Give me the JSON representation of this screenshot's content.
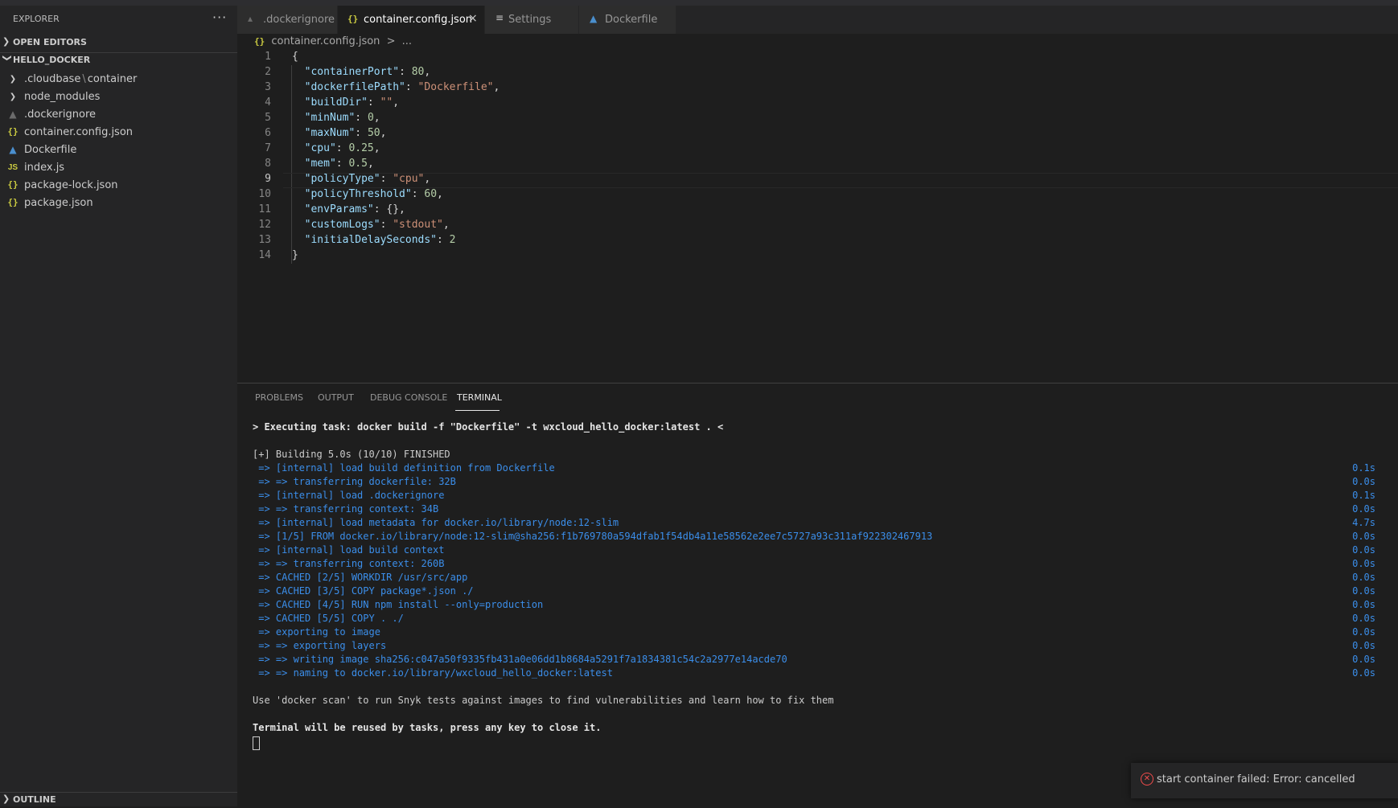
{
  "sidebar": {
    "header": "EXPLORER",
    "more": "···",
    "open_editors": "OPEN EDITORS",
    "project": "HELLO_DOCKER",
    "items": [
      {
        "label": ".cloudbase",
        "sep": "\\",
        "label2": "container",
        "icon": "chevron-right-icon"
      },
      {
        "label": "node_modules",
        "icon": "chevron-right-icon"
      },
      {
        "label": ".dockerignore",
        "icon": "dockerignore-icon"
      },
      {
        "label": "container.config.json",
        "icon": "json-icon",
        "glyph": "{}"
      },
      {
        "label": "Dockerfile",
        "icon": "docker-icon"
      },
      {
        "label": "index.js",
        "icon": "js-icon",
        "glyph": "JS"
      },
      {
        "label": "package-lock.json",
        "icon": "json-icon",
        "glyph": "{}"
      },
      {
        "label": "package.json",
        "icon": "json-icon",
        "glyph": "{}"
      }
    ],
    "outline": "OUTLINE"
  },
  "tabs": [
    {
      "label": ".dockerignore",
      "icon": "dockerignore-icon"
    },
    {
      "label": "container.config.json",
      "icon": "json-icon",
      "glyph": "{}",
      "close": "×"
    },
    {
      "label": "Settings",
      "icon": "settings-list-icon",
      "glyph": "≡"
    },
    {
      "label": "Dockerfile",
      "icon": "docker-icon"
    }
  ],
  "breadcrumb": {
    "glyph": "{}",
    "file": "container.config.json",
    "sep": ">",
    "more": "..."
  },
  "editor": {
    "current_line": 9,
    "lines": [
      {
        "no": "1",
        "parts": [
          [
            "p",
            "{"
          ]
        ]
      },
      {
        "no": "2",
        "parts": [
          [
            "k",
            "  \"containerPort\""
          ],
          [
            "p",
            ": "
          ],
          [
            "n",
            "80"
          ],
          [
            "p",
            ","
          ]
        ]
      },
      {
        "no": "3",
        "parts": [
          [
            "k",
            "  \"dockerfilePath\""
          ],
          [
            "p",
            ": "
          ],
          [
            "s",
            "\"Dockerfile\""
          ],
          [
            "p",
            ","
          ]
        ]
      },
      {
        "no": "4",
        "parts": [
          [
            "k",
            "  \"buildDir\""
          ],
          [
            "p",
            ": "
          ],
          [
            "s",
            "\"\""
          ],
          [
            "p",
            ","
          ]
        ]
      },
      {
        "no": "5",
        "parts": [
          [
            "k",
            "  \"minNum\""
          ],
          [
            "p",
            ": "
          ],
          [
            "n",
            "0"
          ],
          [
            "p",
            ","
          ]
        ]
      },
      {
        "no": "6",
        "parts": [
          [
            "k",
            "  \"maxNum\""
          ],
          [
            "p",
            ": "
          ],
          [
            "n",
            "50"
          ],
          [
            "p",
            ","
          ]
        ]
      },
      {
        "no": "7",
        "parts": [
          [
            "k",
            "  \"cpu\""
          ],
          [
            "p",
            ": "
          ],
          [
            "n",
            "0.25"
          ],
          [
            "p",
            ","
          ]
        ]
      },
      {
        "no": "8",
        "parts": [
          [
            "k",
            "  \"mem\""
          ],
          [
            "p",
            ": "
          ],
          [
            "n",
            "0.5"
          ],
          [
            "p",
            ","
          ]
        ]
      },
      {
        "no": "9",
        "parts": [
          [
            "k",
            "  \"policyType\""
          ],
          [
            "p",
            ": "
          ],
          [
            "s",
            "\"cpu\""
          ],
          [
            "p",
            ","
          ]
        ]
      },
      {
        "no": "10",
        "parts": [
          [
            "k",
            "  \"policyThreshold\""
          ],
          [
            "p",
            ": "
          ],
          [
            "n",
            "60"
          ],
          [
            "p",
            ","
          ]
        ]
      },
      {
        "no": "11",
        "parts": [
          [
            "k",
            "  \"envParams\""
          ],
          [
            "p",
            ": {},"
          ]
        ]
      },
      {
        "no": "12",
        "parts": [
          [
            "k",
            "  \"customLogs\""
          ],
          [
            "p",
            ": "
          ],
          [
            "s",
            "\"stdout\""
          ],
          [
            "p",
            ","
          ]
        ]
      },
      {
        "no": "13",
        "parts": [
          [
            "k",
            "  \"initialDelaySeconds\""
          ],
          [
            "p",
            ": "
          ],
          [
            "n",
            "2"
          ]
        ]
      },
      {
        "no": "14",
        "parts": [
          [
            "p",
            "}"
          ]
        ]
      }
    ]
  },
  "panel": {
    "tabs": [
      "PROBLEMS",
      "OUTPUT",
      "DEBUG CONSOLE",
      "TERMINAL"
    ],
    "active_tab": "TERMINAL",
    "terminal": [
      {
        "text": "> Executing task: docker build -f \"Dockerfile\" -t wxcloud_hello_docker:latest . <",
        "style": "bold",
        "time": ""
      },
      {
        "text": "",
        "style": "",
        "time": ""
      },
      {
        "text": "[+] Building 5.0s (10/10) FINISHED",
        "style": "",
        "time": ""
      },
      {
        "text": " => [internal] load build definition from Dockerfile",
        "style": "blue",
        "time": "0.1s"
      },
      {
        "text": " => => transferring dockerfile: 32B",
        "style": "blue",
        "time": "0.0s"
      },
      {
        "text": " => [internal] load .dockerignore",
        "style": "blue",
        "time": "0.1s"
      },
      {
        "text": " => => transferring context: 34B",
        "style": "blue",
        "time": "0.0s"
      },
      {
        "text": " => [internal] load metadata for docker.io/library/node:12-slim",
        "style": "blue",
        "time": "4.7s"
      },
      {
        "text": " => [1/5] FROM docker.io/library/node:12-slim@sha256:f1b769780a594dfab1f54db4a11e58562e2ee7c5727a93c311af922302467913",
        "style": "blue",
        "time": "0.0s"
      },
      {
        "text": " => [internal] load build context",
        "style": "blue",
        "time": "0.0s"
      },
      {
        "text": " => => transferring context: 260B",
        "style": "blue",
        "time": "0.0s"
      },
      {
        "text": " => CACHED [2/5] WORKDIR /usr/src/app",
        "style": "blue",
        "time": "0.0s"
      },
      {
        "text": " => CACHED [3/5] COPY package*.json ./",
        "style": "blue",
        "time": "0.0s"
      },
      {
        "text": " => CACHED [4/5] RUN npm install --only=production",
        "style": "blue",
        "time": "0.0s"
      },
      {
        "text": " => CACHED [5/5] COPY . ./",
        "style": "blue",
        "time": "0.0s"
      },
      {
        "text": " => exporting to image",
        "style": "blue",
        "time": "0.0s"
      },
      {
        "text": " => => exporting layers",
        "style": "blue",
        "time": "0.0s"
      },
      {
        "text": " => => writing image sha256:c047a50f9335fb431a0e06dd1b8684a5291f7a1834381c54c2a2977e14acde70",
        "style": "blue",
        "time": "0.0s"
      },
      {
        "text": " => => naming to docker.io/library/wxcloud_hello_docker:latest",
        "style": "blue",
        "time": "0.0s"
      },
      {
        "text": "",
        "style": "",
        "time": ""
      },
      {
        "text": "Use 'docker scan' to run Snyk tests against images to find vulnerabilities and learn how to fix them",
        "style": "",
        "time": ""
      },
      {
        "text": "",
        "style": "",
        "time": ""
      },
      {
        "text": "Terminal will be reused by tasks, press any key to close it.",
        "style": "bold",
        "time": ""
      }
    ]
  },
  "notification": {
    "message": "start container failed: Error: cancelled",
    "level": "error",
    "glyph": "✕"
  },
  "colors": {
    "accent": "#3b8eea",
    "error": "#f14c4c",
    "json_icon": "#cbcb41",
    "docker_icon": "#4a8fce"
  }
}
